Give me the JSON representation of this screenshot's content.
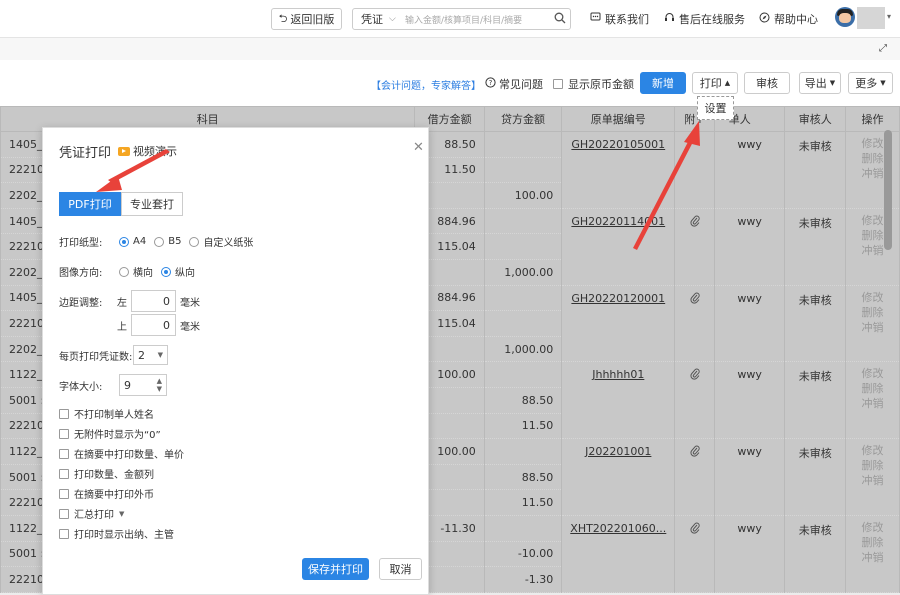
{
  "topbar": {
    "back_label": "返回旧版",
    "search_type": "凭证",
    "search_placeholder": "输入金额/核算项目/科目/摘要",
    "contact": "联系我们",
    "service": "售后在线服务",
    "help": "帮助中心"
  },
  "actionbar": {
    "expert_link": "【会计问题，专家解答】",
    "faq": "常见问题",
    "show_original_currency": "显示原币金额",
    "new_label": "新增",
    "print_label": "打印",
    "audit_label": "审核",
    "export_label": "导出",
    "more_label": "更多",
    "print_dropdown_item": "设置"
  },
  "table": {
    "headers": [
      "科目",
      "借方金额",
      "贷方金额",
      "原单据编号",
      "附件",
      "制单人",
      "审核人",
      "操作"
    ],
    "header_visible": [
      "科目",
      "借方金额",
      "贷方金额",
      "原单据编号",
      "附↑",
      "单人",
      "审核人",
      "操作"
    ],
    "rows": [
      {
        "subject": "1405_",
        "debit": "88.50",
        "credit": "",
        "doc": "GH20220105001",
        "attach": false,
        "maker": "wwy",
        "auditor": "未审核",
        "ops": [
          "修改",
          "删除",
          "冲销"
        ],
        "span": 3
      },
      {
        "subject": "22210",
        "debit": "11.50",
        "credit": ""
      },
      {
        "subject": "2202_",
        "debit": "",
        "credit": "100.00"
      },
      {
        "subject": "1405_",
        "debit": "884.96",
        "credit": "",
        "doc": "GH20220114001",
        "attach": true,
        "maker": "wwy",
        "auditor": "未审核",
        "ops": [
          "修改",
          "删除",
          "冲销"
        ],
        "span": 3
      },
      {
        "subject": "22210",
        "debit": "115.04",
        "credit": ""
      },
      {
        "subject": "2202_",
        "debit": "",
        "credit": "1,000.00"
      },
      {
        "subject": "1405_",
        "debit": "884.96",
        "credit": "",
        "doc": "GH20220120001",
        "attach": true,
        "maker": "wwy",
        "auditor": "未审核",
        "ops": [
          "修改",
          "删除",
          "冲销"
        ],
        "span": 3
      },
      {
        "subject": "22210",
        "debit": "115.04",
        "credit": ""
      },
      {
        "subject": "2202_",
        "debit": "",
        "credit": "1,000.00"
      },
      {
        "subject": "1122_",
        "debit": "100.00",
        "credit": "",
        "doc": "Jhhhhh01",
        "attach": true,
        "maker": "wwy",
        "auditor": "未审核",
        "ops": [
          "修改",
          "删除",
          "冲销"
        ],
        "span": 3
      },
      {
        "subject": "5001 :",
        "debit": "",
        "credit": "88.50"
      },
      {
        "subject": "22210",
        "debit": "",
        "credit": "11.50"
      },
      {
        "subject": "1122_",
        "debit": "100.00",
        "credit": "",
        "doc": "J202201001",
        "attach": true,
        "maker": "wwy",
        "auditor": "未审核",
        "ops": [
          "修改",
          "删除",
          "冲销"
        ],
        "span": 3
      },
      {
        "subject": "5001 :",
        "debit": "",
        "credit": "88.50"
      },
      {
        "subject": "22210",
        "debit": "",
        "credit": "11.50"
      },
      {
        "subject": "1122_",
        "debit": "-11.30",
        "credit": "",
        "doc": "XHT202201060...",
        "attach": true,
        "maker": "wwy",
        "auditor": "未审核",
        "ops": [
          "修改",
          "删除",
          "冲销"
        ],
        "span": 3
      },
      {
        "subject": "5001 :",
        "debit": "",
        "credit": "-10.00"
      },
      {
        "subject": "22210",
        "debit": "",
        "credit": "-1.30"
      }
    ]
  },
  "modal": {
    "title": "凭证打印",
    "video_label": "视频演示",
    "tab_pdf": "PDF打印",
    "tab_pro": "专业套打",
    "paper_label": "打印纸型:",
    "paper_options": [
      "A4",
      "B5",
      "自定义纸张"
    ],
    "paper_selected": "A4",
    "orientation_label": "图像方向:",
    "orientation_options": [
      "横向",
      "纵向"
    ],
    "orientation_selected": "纵向",
    "margin_label": "边距调整:",
    "margin_left_label": "左",
    "margin_left_value": "0",
    "margin_top_label": "上",
    "margin_top_value": "0",
    "margin_unit": "毫米",
    "per_page_label": "每页打印凭证数:",
    "per_page_value": "2",
    "font_size_label": "字体大小:",
    "font_size_value": "9",
    "checkboxes": [
      "不打印制单人姓名",
      "无附件时显示为“0”",
      "在摘要中打印数量、单价",
      "打印数量、金额列",
      "在摘要中打印外币",
      "汇总打印",
      "打印时显示出纳、主管"
    ],
    "save_print": "保存并打印",
    "cancel": "取消"
  },
  "colors": {
    "primary": "#2b85e4",
    "arrow": "#e8423a",
    "link": "#2b7de1"
  }
}
